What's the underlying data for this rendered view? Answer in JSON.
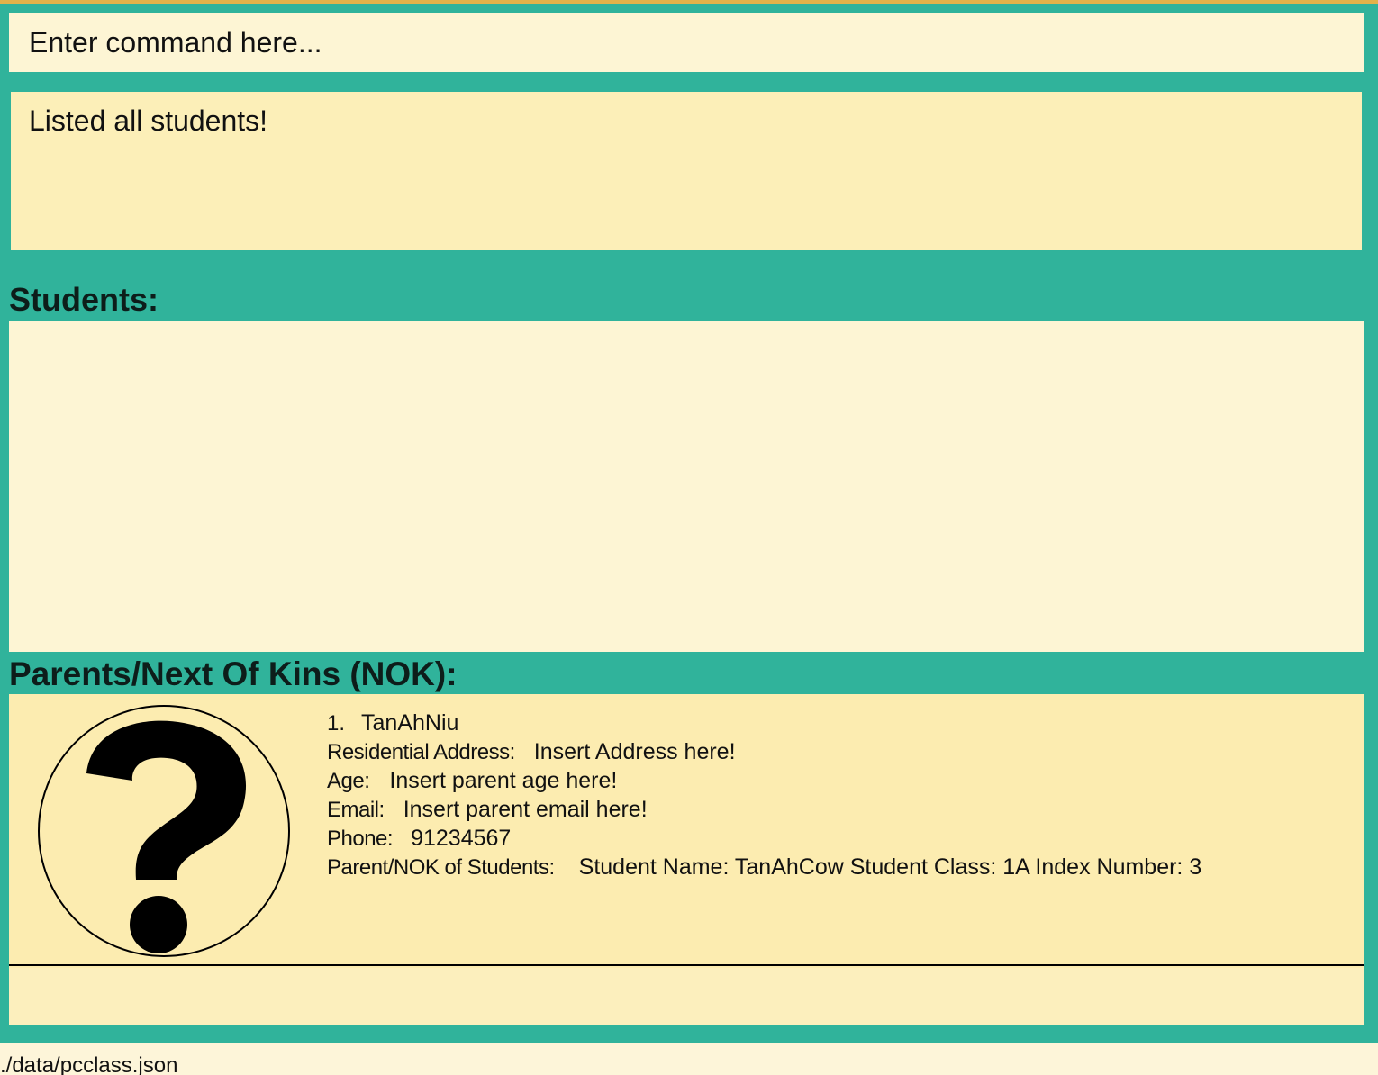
{
  "command": {
    "placeholder": "Enter command here..."
  },
  "result": {
    "message": "Listed all students!"
  },
  "students_panel": {
    "heading": "Students:"
  },
  "nok_panel": {
    "heading": "Parents/Next Of Kins (NOK):",
    "cards": [
      {
        "index": "1.",
        "name": "TanAhNiu",
        "avatar_icon": "question-mark-icon",
        "address_label": "Residential Address:",
        "address": "Insert Address here!",
        "age_label": "Age:",
        "age": "Insert parent age here!",
        "email_label": "Email:",
        "email": "Insert parent email here!",
        "phone_label": "Phone:",
        "phone": "91234567",
        "students_label": "Parent/NOK of Students:",
        "students": "Student Name: TanAhCow Student Class: 1A Index Number: 3"
      }
    ]
  },
  "status_bar": {
    "path": "./data/pcclass.json"
  },
  "colors": {
    "background": "#30b39b",
    "accent": "#e2b24a",
    "panel_light": "#fdf5d4",
    "panel_card": "#fcecb0"
  }
}
